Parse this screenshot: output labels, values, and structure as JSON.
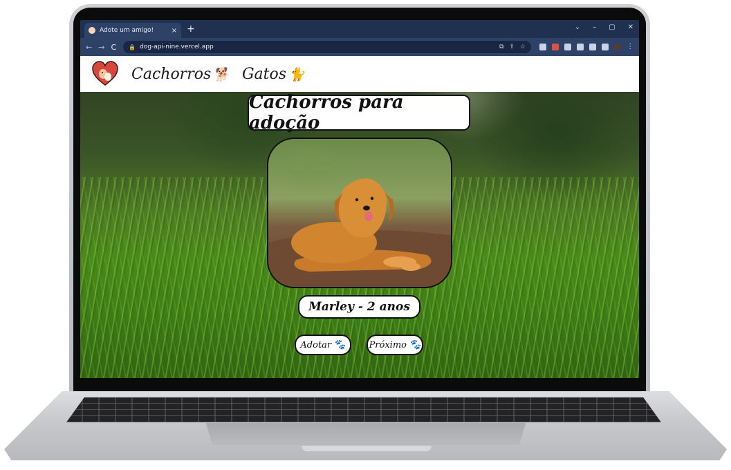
{
  "browser": {
    "tab_title": "Adote um amigo!",
    "tab_close": "×",
    "new_tab": "+",
    "window_controls": [
      "⌄",
      "–",
      "▢",
      "✕"
    ],
    "nav": {
      "back": "←",
      "forward": "→",
      "reload": "C"
    },
    "url": "dog-api-nine.vercel.app"
  },
  "site": {
    "nav": [
      {
        "label": "Cachorros",
        "emoji": "🐕"
      },
      {
        "label": "Gatos",
        "emoji": "🐈"
      }
    ],
    "page_title": "Cachorros para adoção",
    "pet_caption": "Marley - 2 anos",
    "buttons": {
      "adopt": "Adotar",
      "next": "Próximo",
      "paw": "🐾"
    }
  },
  "colors": {
    "browser_tabbar": "#1f3050",
    "browser_toolbar": "#2e4268",
    "page_header": "#ffffff",
    "logo_heart": "#d8473d",
    "dog_coat": "#c97a2a"
  }
}
